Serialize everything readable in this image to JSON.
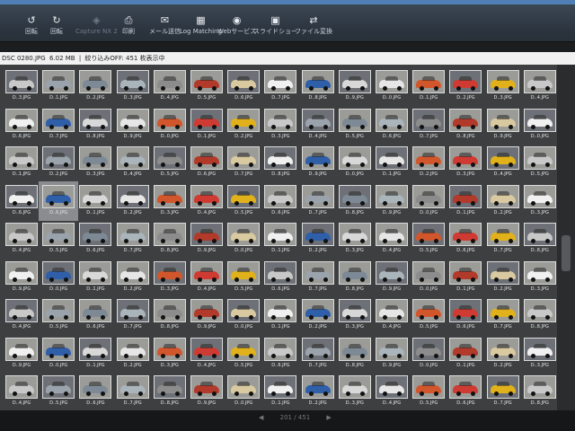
{
  "toolbar": {
    "items": [
      {
        "label": "回転",
        "icon": "rotate-left-icon",
        "glyph": "↺",
        "enabled": true
      },
      {
        "label": "回転",
        "icon": "rotate-right-icon",
        "glyph": "↻",
        "enabled": true
      },
      {
        "label": "Capture NX 2",
        "icon": "capture-nx-icon",
        "glyph": "◈",
        "enabled": false
      },
      {
        "label": "印刷",
        "icon": "print-icon",
        "glyph": "⎙",
        "enabled": true
      },
      {
        "label": "メール送信",
        "icon": "mail-icon",
        "glyph": "✉",
        "enabled": true
      },
      {
        "label": "Log Matching",
        "icon": "log-matching-icon",
        "glyph": "▦",
        "enabled": true
      },
      {
        "label": "Webサービス",
        "icon": "web-service-icon",
        "glyph": "◉",
        "enabled": true
      },
      {
        "label": "スライドショー",
        "icon": "slideshow-icon",
        "glyph": "▣",
        "enabled": true
      },
      {
        "label": "ファイル変換",
        "icon": "file-convert-icon",
        "glyph": "⇄",
        "enabled": true
      }
    ]
  },
  "status": {
    "filename": "DSC 0280.JPG",
    "size": "6.02 MB",
    "filter": "絞り込みOFF: 451 枚表示中"
  },
  "thumbnails": {
    "rows": [
      [
        "D..3.JPG",
        "D..1.JPG",
        "D..2.JPG",
        "D..3.JPG",
        "D..4.JPG",
        "D..5.JPG",
        "D..6.JPG",
        "D..7.JPG",
        "D..8.JPG",
        "D..9.JPG",
        "D..0.JPG",
        "D..1.JPG",
        "D..2.JPG",
        "D..3.JPG",
        "D..4.JPG"
      ],
      [
        "D..6.JPG",
        "D..7.JPG",
        "D..8.JPG",
        "D..9.JPG",
        "D..0.JPG",
        "D..1.JPG",
        "D..2.JPG",
        "D..3.JPG",
        "D..4.JPG",
        "D..5.JPG",
        "D..6.JPG",
        "D..7.JPG",
        "D..8.JPG",
        "D..9.JPG",
        "D..0.JPG"
      ],
      [
        "D..1.JPG",
        "D..2.JPG",
        "D..3.JPG",
        "D..4.JPG",
        "D..5.JPG",
        "D..6.JPG",
        "D..7.JPG",
        "D..8.JPG",
        "D..9.JPG",
        "D..0.JPG",
        "D..1.JPG",
        "D..2.JPG",
        "D..3.JPG",
        "D..4.JPG",
        "D..5.JPG"
      ],
      [
        "D..6.JPG",
        "D..6.JPG",
        "D..1.JPG",
        "D..2.JPG",
        "D..3.JPG",
        "D..4.JPG",
        "D..5.JPG",
        "D..6.JPG",
        "D..7.JPG",
        "D..8.JPG",
        "D..9.JPG",
        "D..0.JPG",
        "D..1.JPG",
        "D..2.JPG",
        "D..3.JPG"
      ],
      [
        "D..4.JPG",
        "D..5.JPG",
        "D..6.JPG",
        "D..7.JPG",
        "D..8.JPG",
        "D..9.JPG",
        "D..0.JPG",
        "D..1.JPG",
        "D..2.JPG",
        "D..3.JPG",
        "D..4.JPG",
        "D..5.JPG",
        "D..6.JPG",
        "D..7.JPG",
        "D..8.JPG"
      ],
      [
        "D..9.JPG",
        "D..0.JPG",
        "D..1.JPG",
        "D..2.JPG",
        "D..3.JPG",
        "D..4.JPG",
        "D..5.JPG",
        "D..6.JPG",
        "D..7.JPG",
        "D..8.JPG",
        "D..9.JPG",
        "D..0.JPG",
        "D..1.JPG",
        "D..2.JPG",
        "D..3.JPG"
      ],
      [
        "D..4.JPG",
        "D..5.JPG",
        "D..6.JPG",
        "D..7.JPG",
        "D..8.JPG",
        "D..9.JPG",
        "D..0.JPG",
        "D..1.JPG",
        "D..2.JPG",
        "D..3.JPG",
        "D..4.JPG",
        "D..5.JPG",
        "D..6.JPG",
        "D..7.JPG",
        "D..8.JPG"
      ],
      [
        "D..9.JPG",
        "D..0.JPG",
        "D..1.JPG",
        "D..2.JPG",
        "D..3.JPG",
        "D..4.JPG",
        "D..5.JPG",
        "D..6.JPG",
        "D..7.JPG",
        "D..8.JPG",
        "D..9.JPG",
        "D..0.JPG",
        "D..1.JPG",
        "D..2.JPG",
        "D..3.JPG"
      ],
      [
        "D..4.JPG",
        "D..5.JPG",
        "D..6.JPG",
        "D..7.JPG",
        "D..8.JPG",
        "D..9.JPG",
        "D..0.JPG",
        "D..1.JPG",
        "D..2.JPG",
        "D..3.JPG",
        "D..4.JPG",
        "D..5.JPG",
        "D..6.JPG",
        "D..7.JPG",
        "D..8.JPG"
      ]
    ],
    "selected": [
      3,
      1
    ],
    "palette": [
      "#c8c8c8",
      "#b23a2a",
      "#e6e6e6",
      "#9aa3ab",
      "#d9c9a0",
      "#d2562b",
      "#7d8a96",
      "#f0f0f0",
      "#cf3b32",
      "#a9b4bb",
      "#2f5fa8",
      "#e0b11a",
      "#8c8c8c",
      "#d8d8d8"
    ]
  },
  "page_nav": {
    "prev": "◀",
    "page": "201 / 451",
    "next": "▶"
  }
}
